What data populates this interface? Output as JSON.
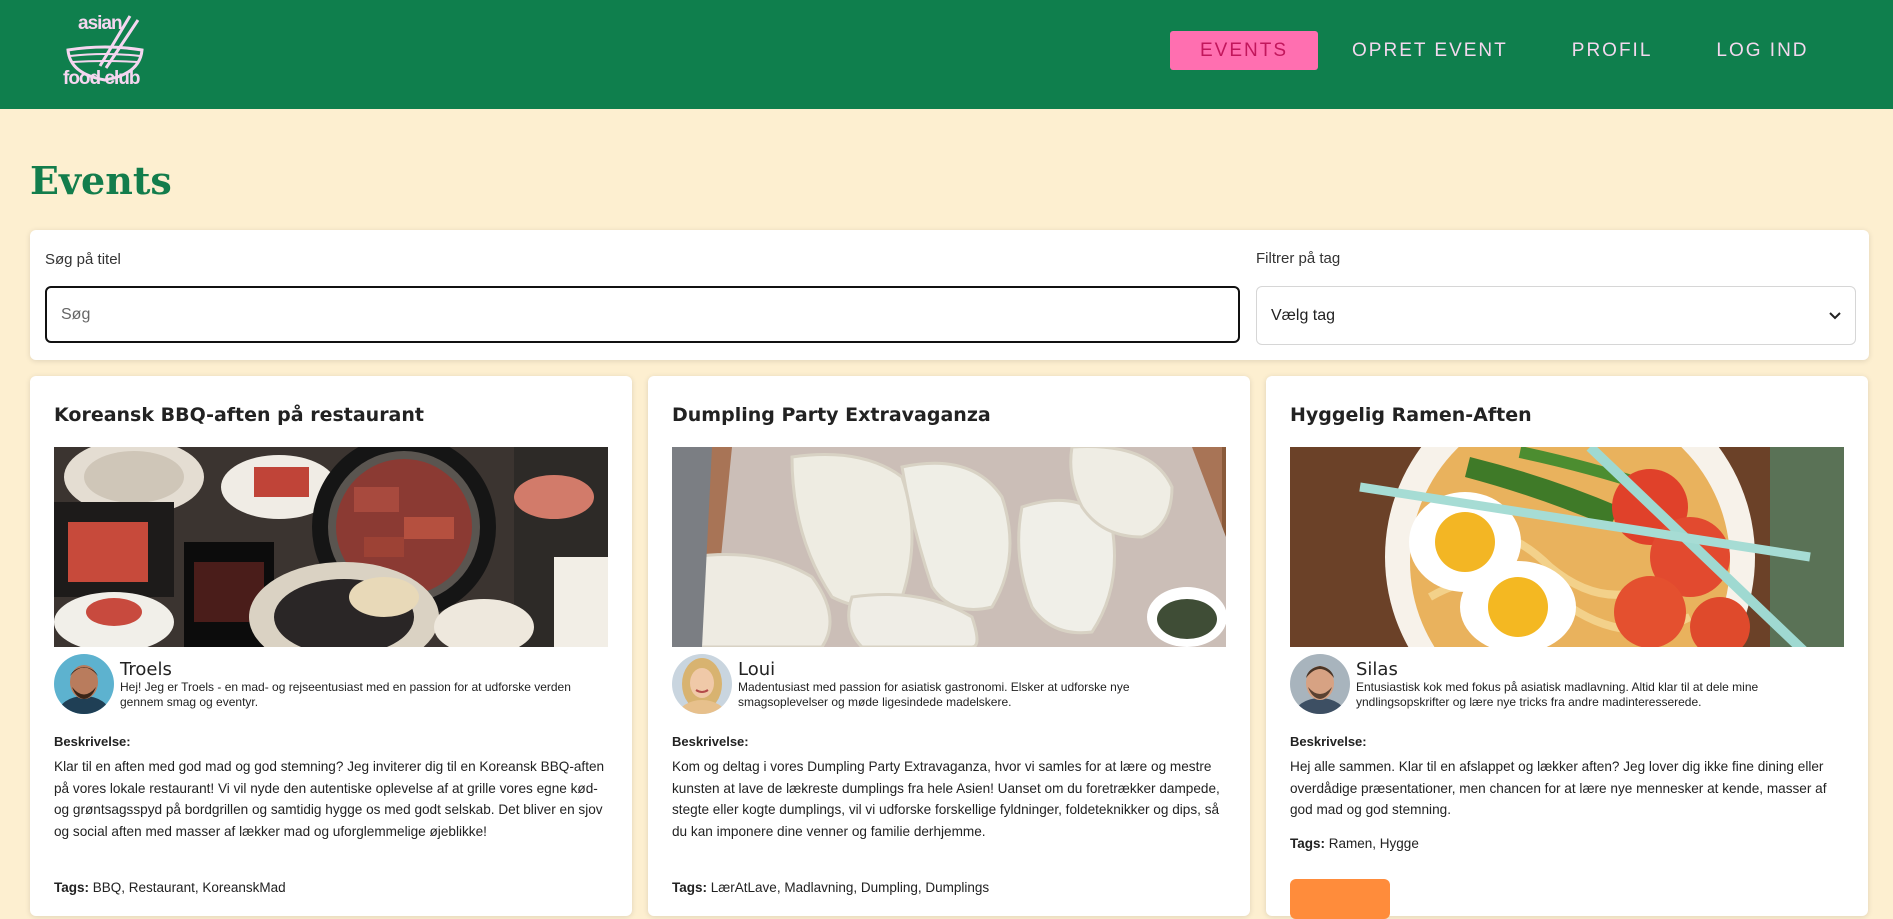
{
  "brand": {
    "logo_top": "asian",
    "logo_bottom": "food club"
  },
  "nav": {
    "items": [
      {
        "label": "EVENTS",
        "active": true
      },
      {
        "label": "OPRET EVENT",
        "active": false
      },
      {
        "label": "PROFIL",
        "active": false
      },
      {
        "label": "LOG IND",
        "active": false
      }
    ]
  },
  "page": {
    "title": "Events"
  },
  "filters": {
    "search_label": "Søg på titel",
    "search_placeholder": "Søg",
    "search_value": "",
    "tag_label": "Filtrer på tag",
    "tag_selected": "Vælg tag"
  },
  "events": [
    {
      "title": "Koreansk BBQ-aften på restaurant",
      "image_icon": "korean-bbq-photo",
      "author_name": "Troels",
      "author_bio": "Hej! Jeg er Troels - en mad- og rejseentusiast med en passion for at udforske verden gennem smag og eventyr.",
      "desc_label": "Beskrivelse:",
      "description": "Klar til en aften med god mad og god stemning? Jeg inviterer dig til en Koreansk BBQ-aften på vores lokale restaurant! Vi vil nyde den autentiske oplevelse af at grille vores egne kød- og grøntsagsspyd på bordgrillen og samtidig hygge os med godt selskab. Det bliver en sjov og social aften med masser af lækker mad og uforglemmelige øjeblikke!",
      "tags_label": "Tags:",
      "tags": "BBQ, Restaurant, KoreanskMad"
    },
    {
      "title": "Dumpling Party Extravaganza",
      "image_icon": "dumplings-photo",
      "author_name": "Loui",
      "author_bio": "Madentusiast med passion for asiatisk gastronomi. Elsker at udforske nye smagsoplevelser og møde ligesindede madelskere.",
      "desc_label": "Beskrivelse:",
      "description": "Kom og deltag i vores Dumpling Party Extravaganza, hvor vi samles for at lære og mestre kunsten at lave de lækreste dumplings fra hele Asien! Uanset om du foretrækker dampede, stegte eller kogte dumplings, vil vi udforske forskellige fyldninger, foldeteknikker og dips, så du kan imponere dine venner og familie derhjemme.",
      "tags_label": "Tags:",
      "tags": "LærAtLave, Madlavning, Dumpling, Dumplings"
    },
    {
      "title": "Hyggelig Ramen-Aften",
      "image_icon": "ramen-photo",
      "author_name": "Silas",
      "author_bio": "Entusiastisk kok med fokus på asiatisk madlavning. Altid klar til at dele mine yndlingsopskrifter og lære nye tricks fra andre madinteresserede.",
      "desc_label": "Beskrivelse:",
      "description": "Hej alle sammen. Klar til en afslappet og lækker aften? Jeg lover dig ikke fine dining eller overdådige præsentationer, men chancen for at lære nye mennesker at kende, masser af god mad og god stemning.",
      "tags_label": "Tags:",
      "tags": "Ramen, Hygge"
    }
  ],
  "colors": {
    "header_bg": "#0f7f4d",
    "page_bg": "#fdefd0",
    "active_nav_bg": "#ff6fb0",
    "title_green": "#137d4c",
    "button_orange": "#ff8c3b"
  }
}
